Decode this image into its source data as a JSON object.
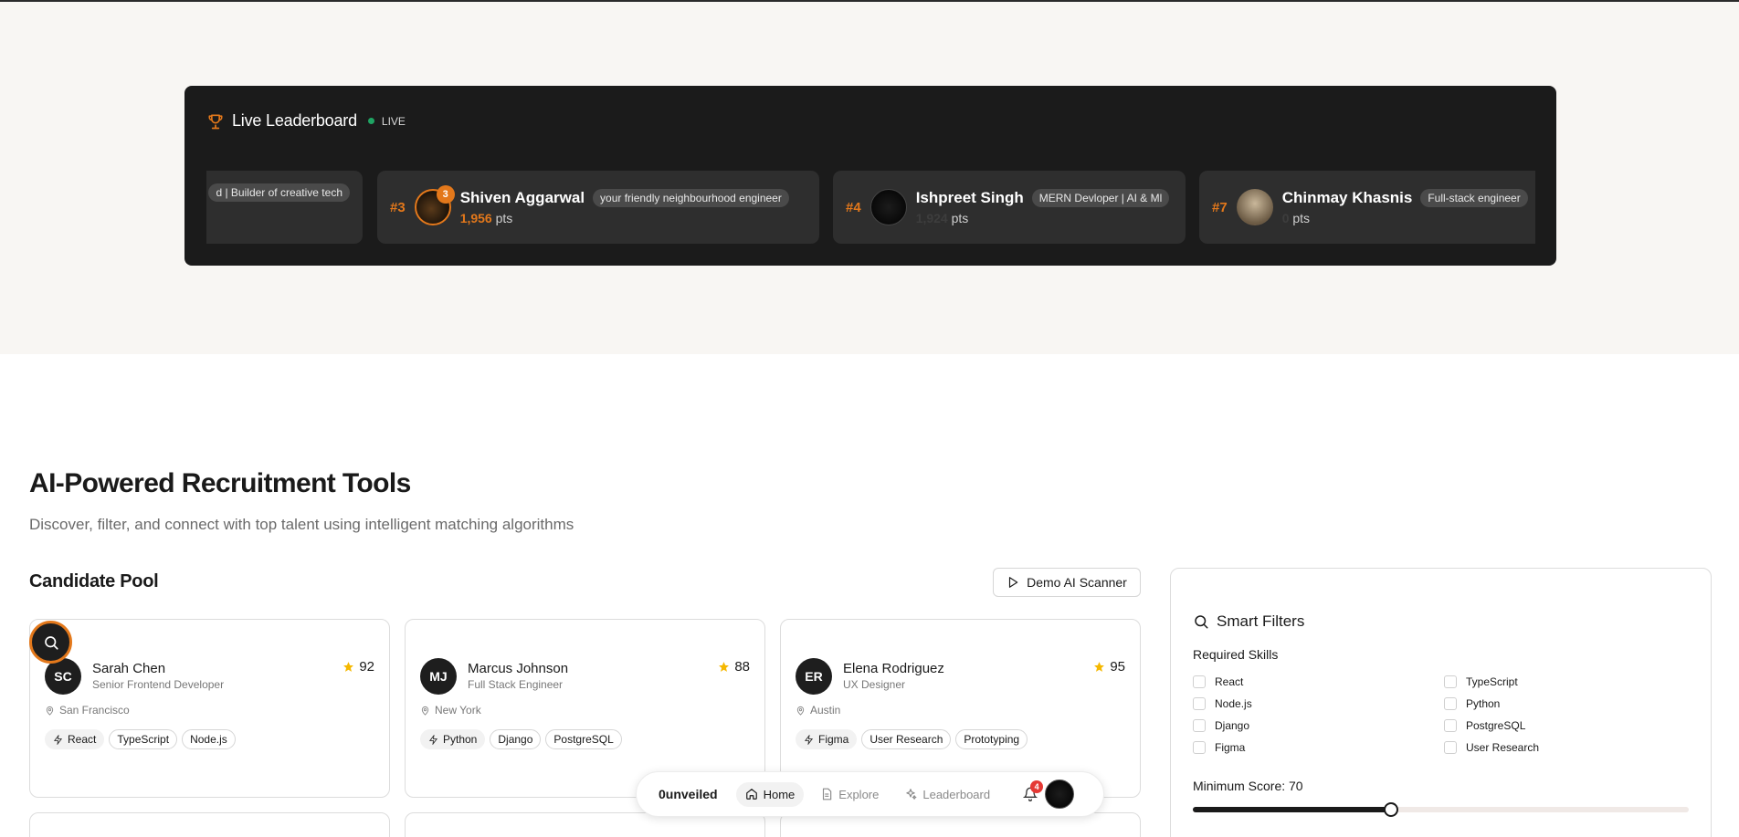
{
  "leaderboard": {
    "title": "Live Leaderboard",
    "live_label": "LIVE",
    "pts_unit": "pts",
    "entries": [
      {
        "rank": "",
        "name": "",
        "tag": "d | Builder of creative tech",
        "points": ""
      },
      {
        "rank": "#3",
        "name": "Shiven Aggarwal",
        "tag": "your friendly neighbourhood engineer",
        "points": "1,956",
        "badge": "3"
      },
      {
        "rank": "#4",
        "name": "Ishpreet Singh",
        "tag": "MERN Devloper | AI & Ml",
        "points": "1,924"
      },
      {
        "rank": "#7",
        "name": "Chinmay Khasnis",
        "tag": "Full-stack engineer",
        "points": "0"
      }
    ]
  },
  "main": {
    "title": "AI-Powered Recruitment Tools",
    "subtitle": "Discover, filter, and connect with top talent using intelligent matching algorithms",
    "pool_title": "Candidate Pool",
    "demo_button": "Demo AI Scanner"
  },
  "candidates": [
    {
      "initials": "SC",
      "name": "Sarah Chen",
      "role": "Senior Frontend Developer",
      "score": "92",
      "location": "San Francisco",
      "skills": [
        "React",
        "TypeScript",
        "Node.js"
      ]
    },
    {
      "initials": "MJ",
      "name": "Marcus Johnson",
      "role": "Full Stack Engineer",
      "score": "88",
      "location": "New York",
      "skills": [
        "Python",
        "Django",
        "PostgreSQL"
      ]
    },
    {
      "initials": "ER",
      "name": "Elena Rodriguez",
      "role": "UX Designer",
      "score": "95",
      "location": "Austin",
      "skills": [
        "Figma",
        "User Research",
        "Prototyping"
      ]
    }
  ],
  "filters": {
    "title": "Smart Filters",
    "required_skills_label": "Required Skills",
    "skills": [
      "React",
      "TypeScript",
      "Node.js",
      "Python",
      "Django",
      "PostgreSQL",
      "Figma",
      "User Research"
    ],
    "min_score_label": "Minimum Score: 70",
    "min_score_value": 70,
    "min_score_fraction": 0.4
  },
  "nav": {
    "brand": "0unveiled",
    "home": "Home",
    "explore": "Explore",
    "leaderboard": "Leaderboard",
    "notifications": "4"
  },
  "colors": {
    "accent": "#e3781b",
    "live": "#1fa463",
    "star": "#f5b800"
  }
}
